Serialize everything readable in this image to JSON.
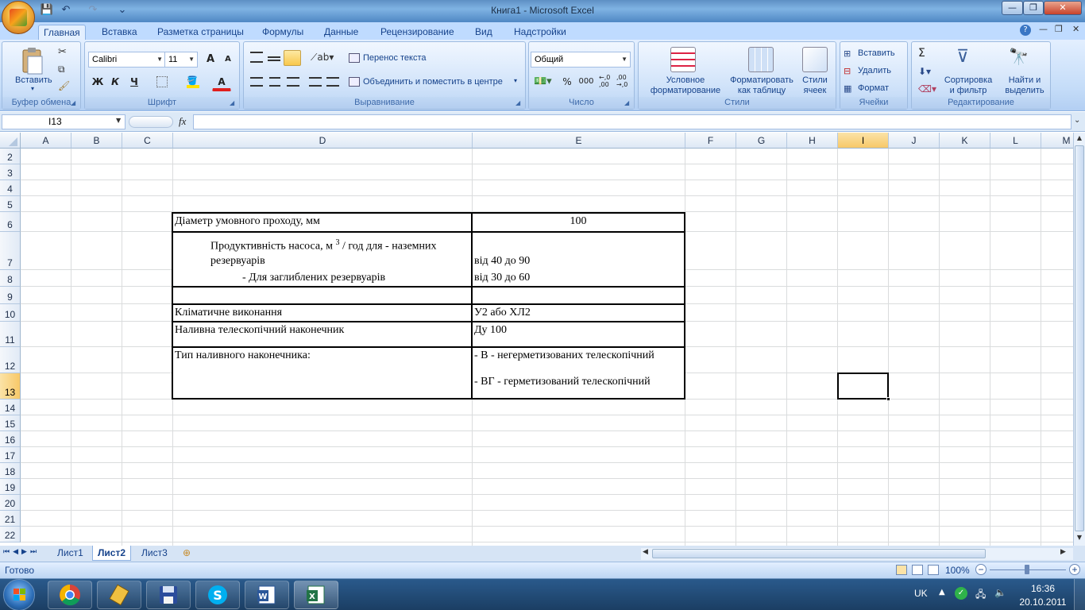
{
  "window": {
    "title": "Книга1 - Microsoft Excel",
    "minimize": "—",
    "maximize": "❐",
    "close": "✕"
  },
  "quick_access": {
    "save": "💾",
    "undo": "↶",
    "redo": "↷",
    "customize": "⌄"
  },
  "ribbon_tabs": [
    "Главная",
    "Вставка",
    "Разметка страницы",
    "Формулы",
    "Данные",
    "Рецензирование",
    "Вид",
    "Надстройки"
  ],
  "ribbon": {
    "clipboard": {
      "paste": "Вставить",
      "label": "Буфер обмена"
    },
    "font": {
      "name": "Calibri",
      "size": "11",
      "bold": "Ж",
      "italic": "К",
      "underline": "Ч",
      "grow": "A",
      "shrink": "A",
      "color_letter": "A",
      "label": "Шрифт"
    },
    "alignment": {
      "wrap": "Перенос текста",
      "merge": "Объединить и поместить в центре",
      "label": "Выравнивание"
    },
    "number": {
      "format": "Общий",
      "percent": "%",
      "thousands": "000",
      "inc_dec": ",0\n,00",
      "dec_dec": ",00\n,0",
      "label": "Число"
    },
    "styles": {
      "cond_format": "Условное\nформатирование",
      "format_table": "Форматировать\nкак таблицу",
      "cell_styles": "Стили\nячеек",
      "label": "Стили"
    },
    "cells": {
      "insert": "Вставить",
      "delete": "Удалить",
      "format": "Формат",
      "label": "Ячейки"
    },
    "editing": {
      "sum": "Σ",
      "sort": "Сортировка\nи фильтр",
      "find": "Найти и\nвыделить",
      "label": "Редактирование"
    }
  },
  "formula_bar": {
    "name_box": "I13",
    "fx": "fx",
    "formula": ""
  },
  "columns": [
    "A",
    "B",
    "C",
    "D",
    "E",
    "F",
    "G",
    "H",
    "I",
    "J",
    "K",
    "L",
    "M"
  ],
  "rows": [
    "2",
    "3",
    "4",
    "5",
    "6",
    "7",
    "8",
    "9",
    "10",
    "11",
    "12",
    "13",
    "14",
    "15",
    "16",
    "17",
    "18",
    "19",
    "20",
    "21",
    "22"
  ],
  "selected_cell": {
    "column": "I",
    "row": "13"
  },
  "cells": {
    "d6": "Діаметр умовного проходу, мм",
    "e6": "100",
    "d7a": "Продуктивність насоса, м",
    "d7sup": "3",
    "d7b": "/ год для - наземних",
    "d7c": "резервуарів",
    "e7": "від 40 до 90",
    "d8": "- Для заглиблених резервуарів",
    "e8": "від 30 до 60",
    "d10": "Кліматичне виконання",
    "e10": "У2 або ХЛ2",
    "d11": "Наливна телескопічний наконечник",
    "e11": "Ду 100",
    "d12": "Тип наливного наконечника:",
    "e12": "- В - негерметизованих телескопічний",
    "e13": "- ВГ - герметизований телескопічний"
  },
  "sheets": [
    "Лист1",
    "Лист2",
    "Лист3"
  ],
  "active_sheet": "Лист2",
  "status": {
    "ready": "Готово",
    "zoom": "100%",
    "zoom_out": "−",
    "zoom_in": "+"
  },
  "taskbar": {
    "apps": [
      "windows-start",
      "chrome",
      "app-tool",
      "save-app",
      "skype",
      "word",
      "excel"
    ],
    "lang": "UK",
    "time": "16:36",
    "date": "20.10.2011"
  },
  "colors": {
    "accent": "#15428b",
    "ribbon_bg": "#c4dcf8",
    "selection": "#f7c868",
    "taskbar": "#1b3e63"
  }
}
